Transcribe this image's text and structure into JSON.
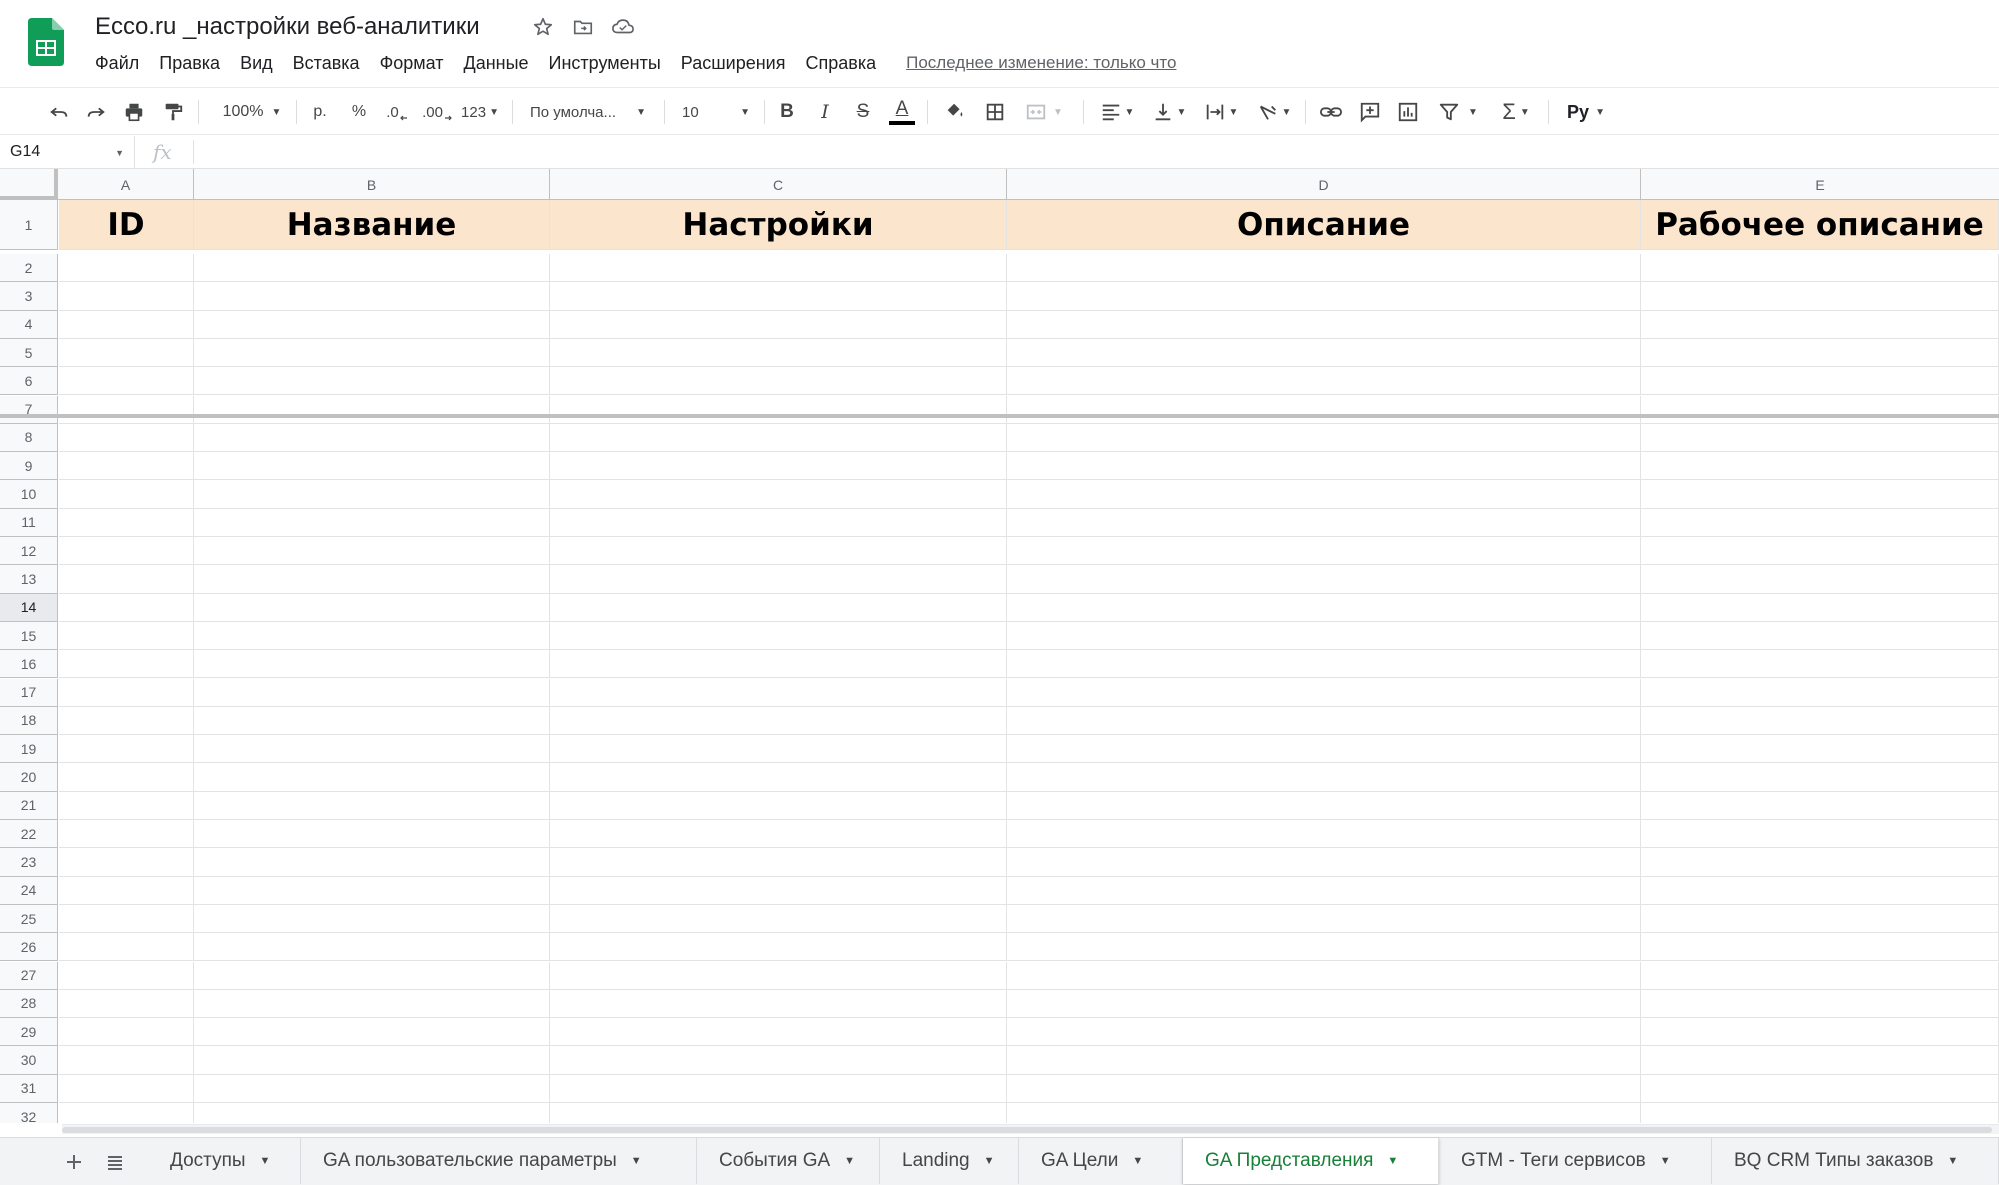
{
  "doc": {
    "title": "Ecco.ru _настройки веб-аналитики",
    "logo_icon": "sheets-logo-icon",
    "brand_color": "#0f9d58"
  },
  "menu": [
    "Файл",
    "Правка",
    "Вид",
    "Вставка",
    "Формат",
    "Данные",
    "Инструменты",
    "Расширения",
    "Справка"
  ],
  "last_edit": "Последнее изменение: только что",
  "toolbar": {
    "zoom": "100%",
    "currency": "р.",
    "percent": "%",
    "decrease_decimals": ".0",
    "increase_decimals": ".00",
    "more_formats": "123",
    "font": "По умолча...",
    "font_size": "10",
    "bold": "B",
    "italic": "I",
    "strikethrough": "S",
    "text_color": "A",
    "sigma": "Σ",
    "input_tools": "Py"
  },
  "formula_bar": {
    "name_box": "G14",
    "fx": "fx",
    "value": ""
  },
  "grid": {
    "columns": [
      "A",
      "B",
      "C",
      "D",
      "E"
    ],
    "rows": [
      "1",
      "2",
      "3",
      "4",
      "5",
      "6",
      "7",
      "8",
      "9",
      "10",
      "11",
      "12",
      "13",
      "14",
      "15",
      "16",
      "17",
      "18",
      "19",
      "20",
      "21",
      "22",
      "23",
      "24",
      "25",
      "26",
      "27",
      "28",
      "29",
      "30",
      "31",
      "32"
    ],
    "active_row": "14",
    "header_fill": "#fce5cd",
    "header_cells": [
      "ID",
      "Название",
      "Настройки",
      "Описание",
      "Рабочее описание"
    ]
  },
  "sheet_tabs": {
    "active_color": "#188038",
    "tabs": [
      "Доступы",
      "GA пользовательские параметры",
      "События GA",
      "Landing",
      "GA Цели",
      "GA Представления",
      "GTM - Теги сервисов",
      "BQ CRM Типы заказов"
    ],
    "active": "GA Представления"
  }
}
